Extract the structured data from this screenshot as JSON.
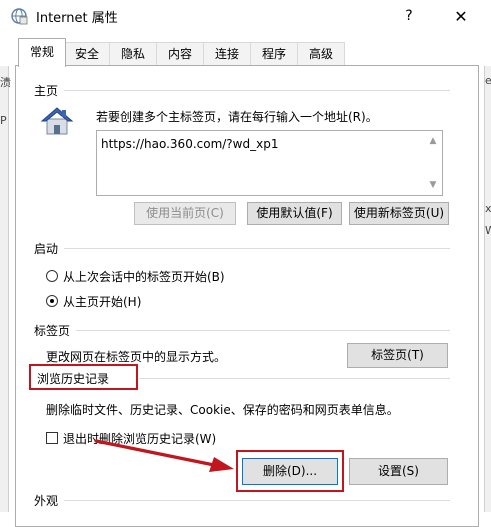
{
  "window": {
    "title": "Internet 属性",
    "help_label": "?",
    "close_label": "✕"
  },
  "tabs": [
    {
      "label": "常规",
      "active": true
    },
    {
      "label": "安全",
      "active": false
    },
    {
      "label": "隐私",
      "active": false
    },
    {
      "label": "内容",
      "active": false
    },
    {
      "label": "连接",
      "active": false
    },
    {
      "label": "程序",
      "active": false
    },
    {
      "label": "高级",
      "active": false
    }
  ],
  "background_glyphs": {
    "left_1": "渍",
    "left_2": "P",
    "right_1": "e",
    "right_2": "x",
    "right_3": "W"
  },
  "homepage": {
    "group_label": "主页",
    "instruction": "若要创建多个主标签页，请在每行输入一个地址(R)。",
    "url": "https://hao.360.com/?wd_xp1",
    "use_current_label": "使用当前页(C)",
    "use_default_label": "使用默认值(F)",
    "use_new_tab_label": "使用新标签页(U)"
  },
  "startup": {
    "group_label": "启动",
    "option_last_session": "从上次会话中的标签页开始(B)",
    "option_homepage": "从主页开始(H)",
    "selected": "option_homepage"
  },
  "tabs_section": {
    "group_label": "标签页",
    "description": "更改网页在标签页中的显示方式。",
    "button_label": "标签页(T)"
  },
  "history": {
    "group_label": "浏览历史记录",
    "description": "删除临时文件、历史记录、Cookie、保存的密码和网页表单信息。",
    "checkbox_label": "退出时删除浏览历史记录(W)",
    "checkbox_checked": false,
    "delete_label": "删除(D)...",
    "settings_label": "设置(S)"
  },
  "appearance": {
    "group_label": "外观"
  },
  "colors": {
    "highlight": "#c0161d",
    "house_roof": "#3a66b5",
    "house_wall": "#d9dde6"
  }
}
